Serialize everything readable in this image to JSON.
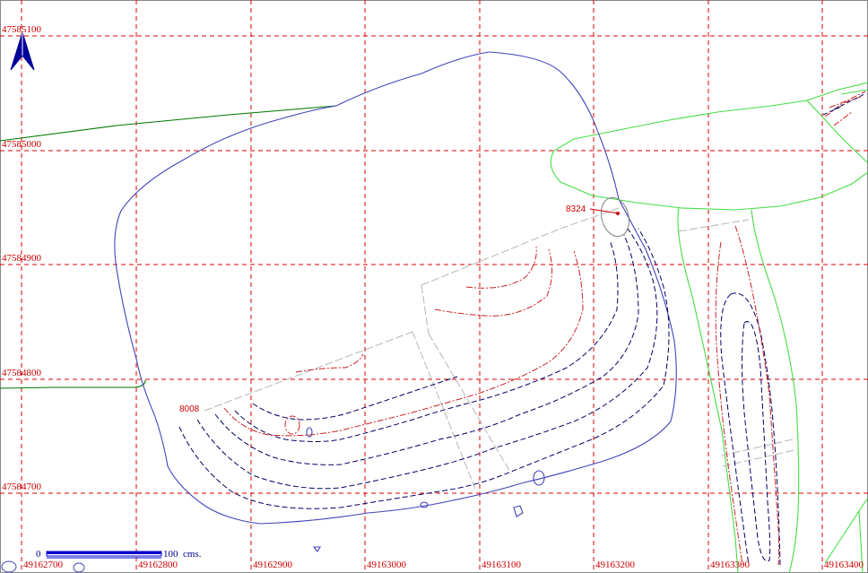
{
  "map": {
    "grid_x_labels": [
      "49162700",
      "49162800",
      "49162900",
      "49163000",
      "49163100",
      "49163200",
      "49163300",
      "49163400"
    ],
    "grid_y_labels": [
      "47585100",
      "47585000",
      "47584900",
      "47584800",
      "47584700"
    ],
    "labels": {
      "point_8324": "8324",
      "point_8008": "8008"
    },
    "scale_bar": {
      "start": "0",
      "end": "100",
      "unit": "cms."
    },
    "colors": {
      "grid": "#dd0000",
      "boundary_blue": "#4444bb",
      "boundary_green_dark": "#007700",
      "boundary_green_light": "#44dd44",
      "contour_navy": "#000066",
      "contour_red": "#cc2222",
      "north_arrow": "#000099"
    },
    "icons": [
      "north-arrow-icon"
    ]
  }
}
